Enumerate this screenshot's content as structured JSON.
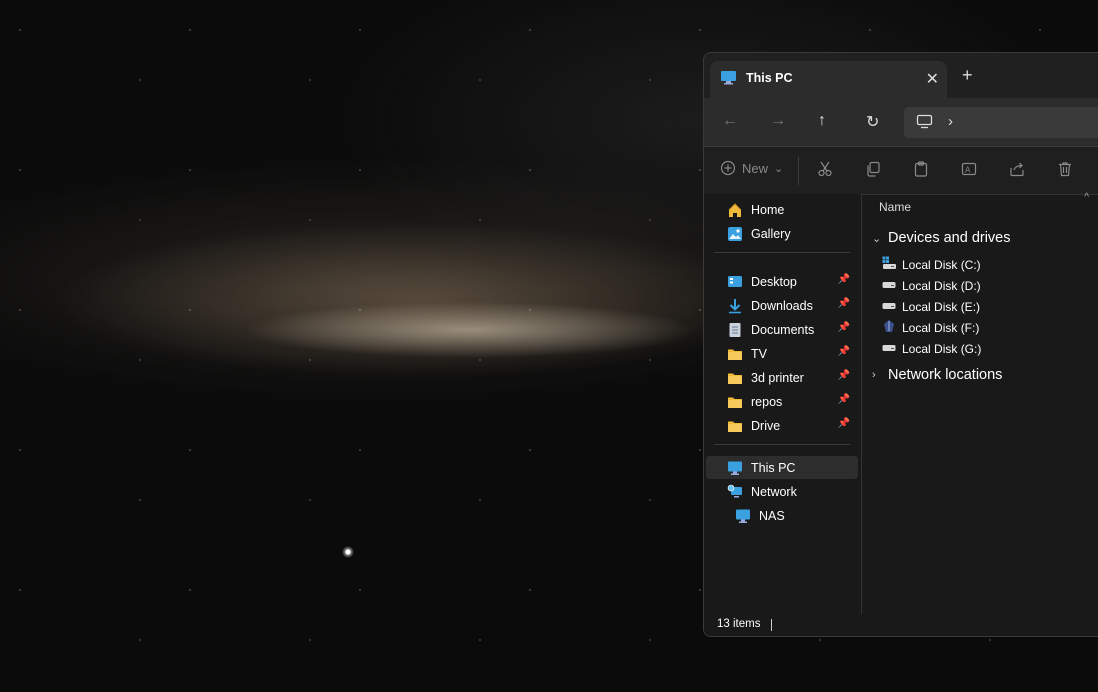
{
  "window": {
    "tab_title": "This PC",
    "tab_close": "✕",
    "new_tab": "+"
  },
  "navbar": {
    "back": "←",
    "forward": "→",
    "up": "↑",
    "refresh": "↻",
    "breadcrumb_chevron": "›"
  },
  "toolbar": {
    "new_label": "New",
    "new_chevron": "⌄",
    "tools": [
      "cut-icon",
      "copy-icon",
      "paste-icon",
      "rename-icon",
      "share-icon",
      "delete-icon"
    ]
  },
  "sidebar": {
    "home": "Home",
    "gallery": "Gallery",
    "pinned": [
      {
        "label": "Desktop",
        "icon": "desktop-icon"
      },
      {
        "label": "Downloads",
        "icon": "downloads-icon"
      },
      {
        "label": "Documents",
        "icon": "documents-icon"
      },
      {
        "label": "TV",
        "icon": "folder-icon"
      },
      {
        "label": "3d printer",
        "icon": "folder-icon"
      },
      {
        "label": "repos",
        "icon": "folder-icon"
      },
      {
        "label": "Drive",
        "icon": "folder-icon"
      }
    ],
    "this_pc": "This PC",
    "network": "Network",
    "nas": "NAS"
  },
  "content": {
    "column_name": "Name",
    "group_devices": "Devices and drives",
    "drives": [
      "Local Disk (C:)",
      "Local Disk (D:)",
      "Local Disk (E:)",
      "Local Disk (F:)",
      "Local Disk (G:)"
    ],
    "group_network": "Network locations"
  },
  "status": {
    "item_count": "13 items"
  },
  "colors": {
    "window_bg": "#191919",
    "folder": "#f0b93a",
    "pc_blue": "#3aa0e0"
  }
}
